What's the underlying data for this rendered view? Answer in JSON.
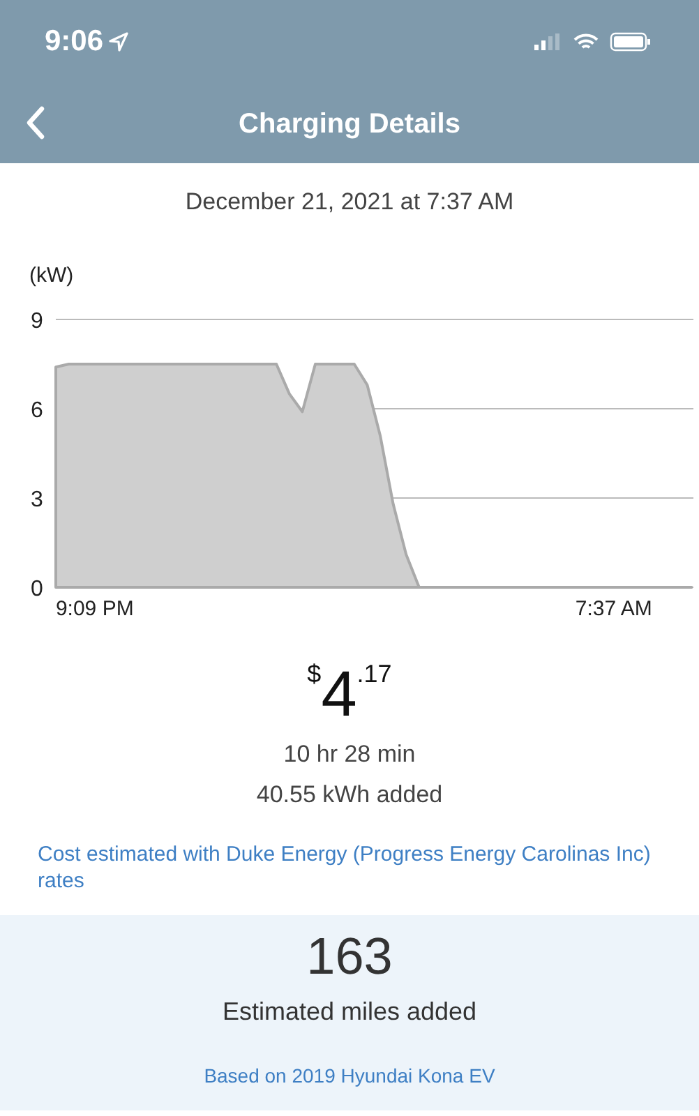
{
  "status_bar": {
    "time": "9:06"
  },
  "nav": {
    "title": "Charging Details"
  },
  "date": "December 21, 2021 at 7:37 AM",
  "chart_data": {
    "type": "area",
    "ylabel": "(kW)",
    "yticks": [
      0,
      3,
      6,
      9
    ],
    "ylim": [
      0,
      9
    ],
    "categories": [
      null,
      null,
      null,
      "9:09 PM",
      null,
      null,
      null,
      null,
      null,
      null,
      null,
      null,
      null,
      null,
      null,
      null,
      null,
      null,
      null,
      null,
      null,
      null,
      null,
      null,
      null,
      null,
      null,
      null,
      null,
      null,
      null,
      null,
      null,
      null,
      null,
      null,
      null,
      null,
      null,
      null,
      null,
      null,
      null,
      "7:37 AM",
      null,
      null,
      null,
      null,
      null,
      null
    ],
    "series": [
      {
        "color": "#cfcfcf",
        "values": [
          7.4,
          7.5,
          7.5,
          7.5,
          7.5,
          7.5,
          7.5,
          7.5,
          7.5,
          7.5,
          7.5,
          7.5,
          7.5,
          7.5,
          7.5,
          7.5,
          7.5,
          7.5,
          6.5,
          5.9,
          7.5,
          7.5,
          7.5,
          7.5,
          6.8,
          5.1,
          2.8,
          1.1,
          0,
          0,
          0,
          0,
          0,
          0,
          0,
          0,
          0,
          0,
          0,
          0,
          0,
          0,
          0,
          0,
          0,
          0,
          0,
          0,
          0,
          0
        ]
      }
    ]
  },
  "cost": {
    "currency": "$",
    "whole": "4",
    "cents": ".17"
  },
  "duration": "10 hr 28 min",
  "energy": "40.55 kWh added",
  "rate_note": "Cost estimated with Duke Energy (Progress Energy Carolinas Inc) rates",
  "miles": {
    "value": "163",
    "label": "Estimated miles added",
    "note": "Based on 2019 Hyundai Kona EV"
  }
}
